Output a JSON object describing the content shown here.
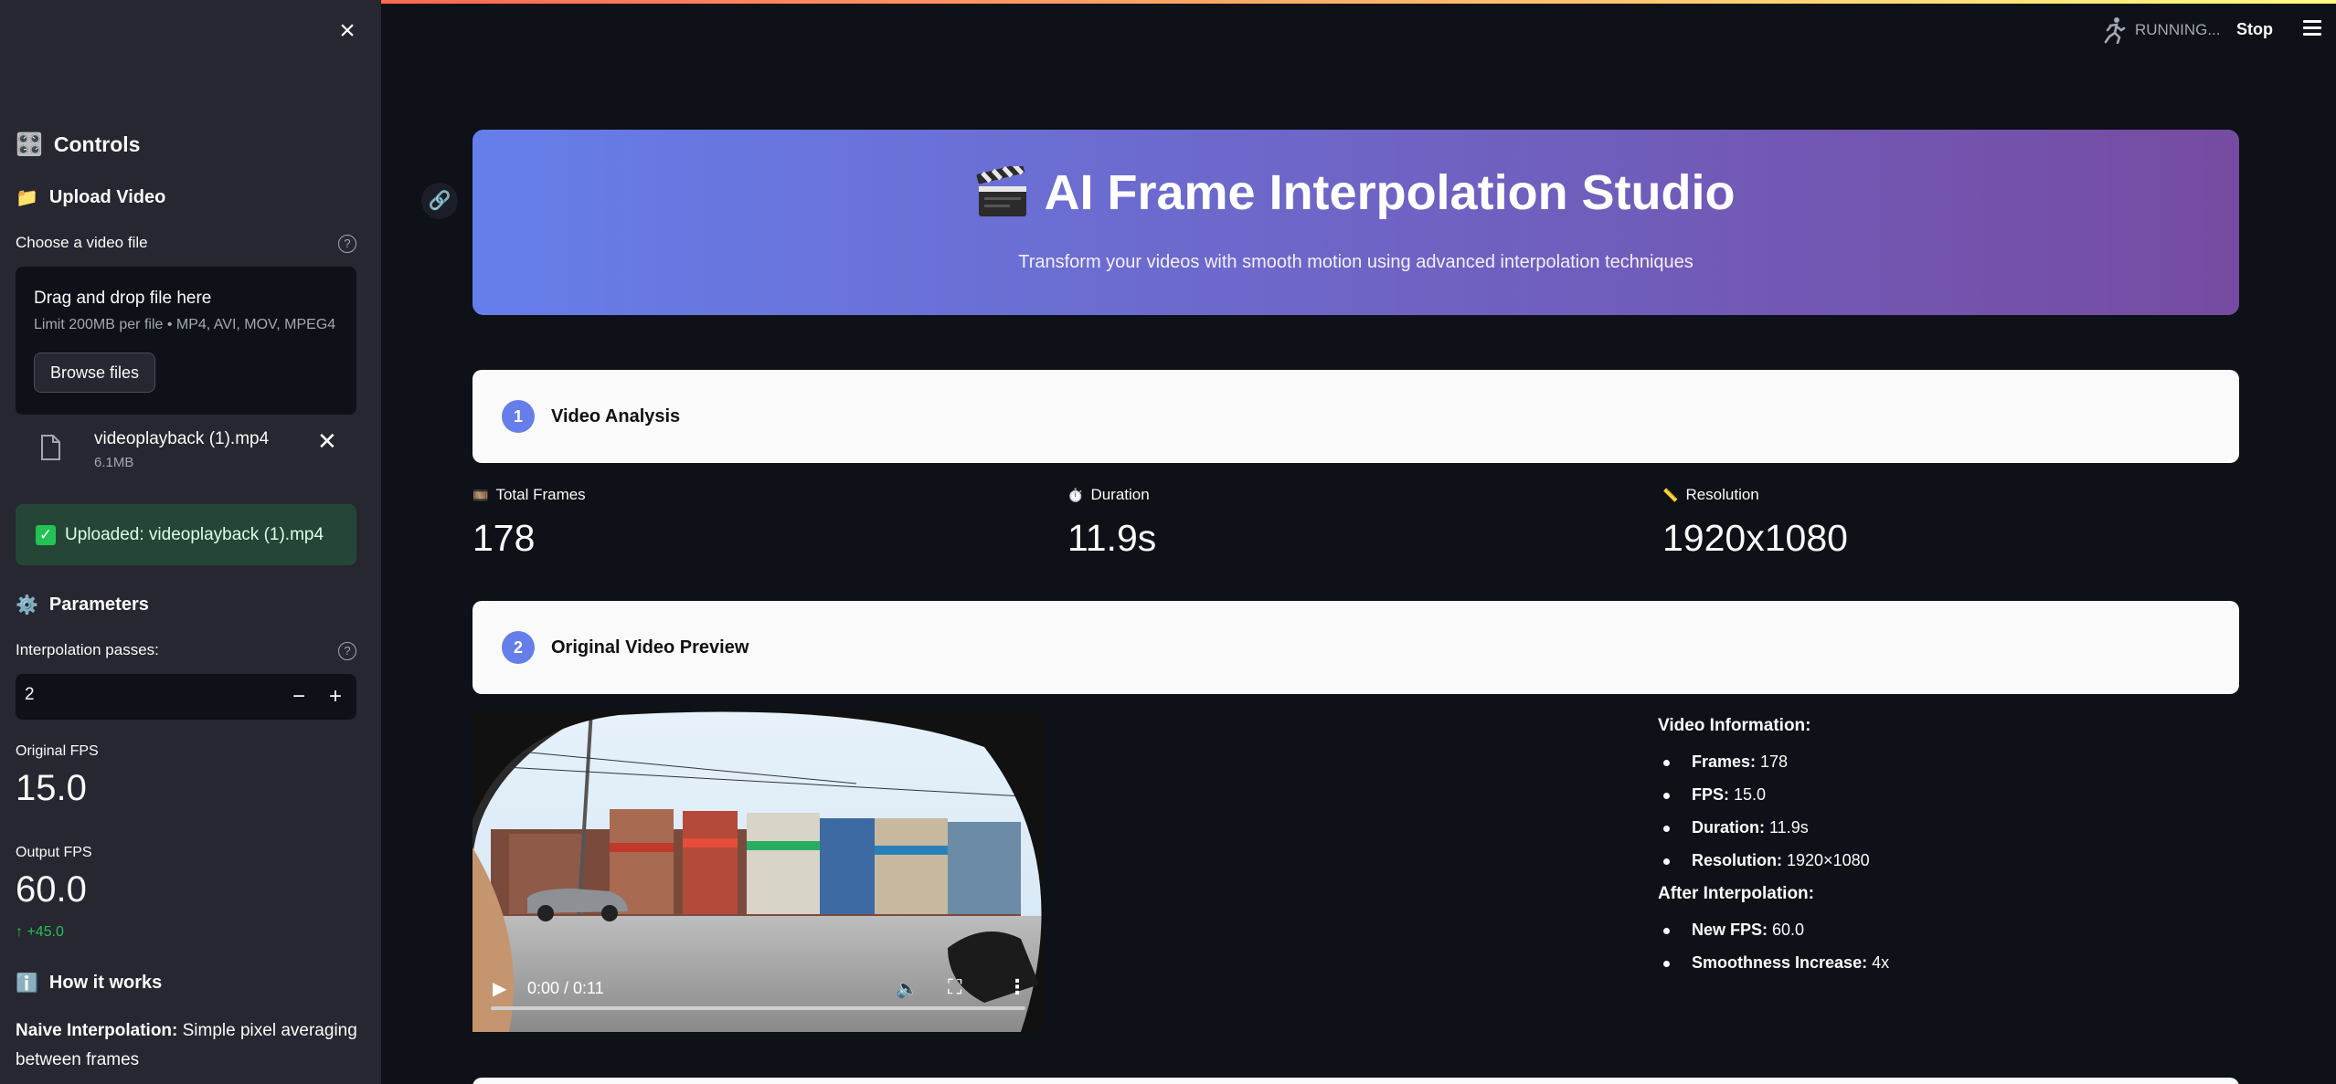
{
  "header": {
    "status": "RUNNING...",
    "stop_label": "Stop"
  },
  "sidebar": {
    "controls_emoji": "🎛️",
    "controls_title": "Controls",
    "upload_emoji": "📁",
    "upload_title": "Upload Video",
    "file_label": "Choose a video file",
    "dropzone_title": "Drag and drop file here",
    "dropzone_limit": "Limit 200MB per file • MP4, AVI, MOV, MPEG4",
    "browse_label": "Browse files",
    "file_name": "videoplayback (1).mp4",
    "file_size": "6.1MB",
    "success_text": "Uploaded: videoplayback (1).mp4",
    "params_emoji": "⚙️",
    "params_title": "Parameters",
    "passes_label": "Interpolation passes:",
    "passes_value": "2",
    "original_fps_label": "Original FPS",
    "original_fps_value": "15.0",
    "output_fps_label": "Output FPS",
    "output_fps_value": "60.0",
    "output_fps_delta": "+45.0",
    "how_emoji": "ℹ️",
    "how_title": "How it works",
    "how_bold": "Naive Interpolation:",
    "how_text": " Simple pixel averaging between frames"
  },
  "hero": {
    "title": "AI Frame Interpolation Studio",
    "subtitle": "Transform your videos with smooth motion using advanced interpolation techniques"
  },
  "steps": [
    {
      "num": "1",
      "title": "Video Analysis"
    },
    {
      "num": "2",
      "title": "Original Video Preview"
    }
  ],
  "metrics": [
    {
      "emoji": "🎞️",
      "label": "Total Frames",
      "value": "178"
    },
    {
      "emoji": "⏱️",
      "label": "Duration",
      "value": "11.9s"
    },
    {
      "emoji": "📏",
      "label": "Resolution",
      "value": "1920x1080"
    }
  ],
  "video": {
    "time": "0:00 / 0:11"
  },
  "info": {
    "heading": "Video Information:",
    "items": [
      {
        "k": "Frames:",
        "v": " 178"
      },
      {
        "k": "FPS:",
        "v": " 15.0"
      },
      {
        "k": "Duration:",
        "v": " 11.9s"
      },
      {
        "k": "Resolution:",
        "v": " 1920×1080"
      }
    ],
    "after_heading": "After Interpolation:",
    "after_items": [
      {
        "k": "New FPS:",
        "v": " 60.0"
      },
      {
        "k": "Smoothness Increase:",
        "v": " 4x"
      }
    ]
  }
}
